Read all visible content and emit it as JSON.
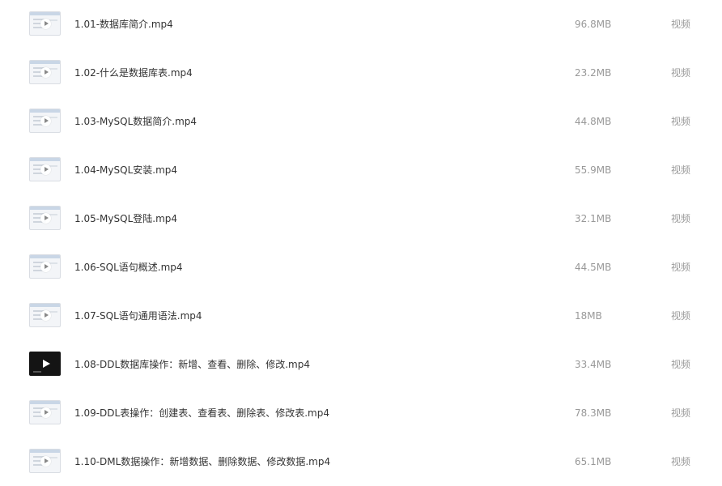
{
  "files": [
    {
      "name": "1.01-数据库简介.mp4",
      "size": "96.8MB",
      "type": "视频",
      "thumb": "slide"
    },
    {
      "name": "1.02-什么是数据库表.mp4",
      "size": "23.2MB",
      "type": "视频",
      "thumb": "slide"
    },
    {
      "name": "1.03-MySQL数据简介.mp4",
      "size": "44.8MB",
      "type": "视频",
      "thumb": "slide"
    },
    {
      "name": "1.04-MySQL安装.mp4",
      "size": "55.9MB",
      "type": "视频",
      "thumb": "slide"
    },
    {
      "name": "1.05-MySQL登陆.mp4",
      "size": "32.1MB",
      "type": "视频",
      "thumb": "slide"
    },
    {
      "name": "1.06-SQL语句概述.mp4",
      "size": "44.5MB",
      "type": "视频",
      "thumb": "slide"
    },
    {
      "name": "1.07-SQL语句通用语法.mp4",
      "size": "18MB",
      "type": "视频",
      "thumb": "slide"
    },
    {
      "name": "1.08-DDL数据库操作：新增、查看、删除、修改.mp4",
      "size": "33.4MB",
      "type": "视频",
      "thumb": "dark"
    },
    {
      "name": "1.09-DDL表操作：创建表、查看表、删除表、修改表.mp4",
      "size": "78.3MB",
      "type": "视频",
      "thumb": "slide"
    },
    {
      "name": "1.10-DML数据操作：新增数据、删除数据、修改数据.mp4",
      "size": "65.1MB",
      "type": "视频",
      "thumb": "slide"
    }
  ],
  "icons": {
    "thumbnail": "video-thumbnail-icon",
    "play": "play-icon"
  },
  "colors": {
    "name_text": "#333333",
    "meta_text": "#999999"
  }
}
